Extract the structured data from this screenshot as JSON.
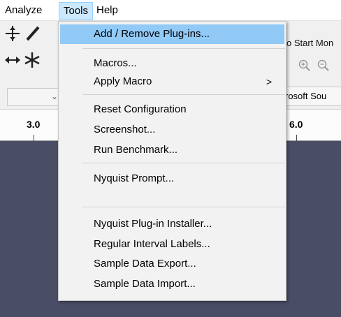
{
  "menubar": {
    "items": [
      {
        "label": "Analyze"
      },
      {
        "label": "Tools"
      },
      {
        "label": "Help"
      }
    ]
  },
  "toolbar": {
    "playback_text": "o Start Mon",
    "device_text": "rosoft Sou",
    "combo_arrow": "⌄"
  },
  "ruler": {
    "labels": [
      "3.0",
      "6.0"
    ]
  },
  "tools_menu": {
    "items": [
      {
        "label": "Add / Remove Plug-ins..."
      },
      {
        "label": "Macros..."
      },
      {
        "label": "Apply Macro",
        "submenu_arrow": ">"
      },
      {
        "label": "Reset Configuration"
      },
      {
        "label": "Screenshot..."
      },
      {
        "label": "Run Benchmark..."
      },
      {
        "label": "Nyquist Prompt..."
      },
      {
        "label": "Nyquist Plug-in Installer..."
      },
      {
        "label": "Regular Interval Labels..."
      },
      {
        "label": "Sample Data Export..."
      },
      {
        "label": "Sample Data Import..."
      }
    ]
  },
  "colors": {
    "highlight": "#91c9f7",
    "track_background": "#4a4d66",
    "menu_active": "#cce8ff"
  }
}
